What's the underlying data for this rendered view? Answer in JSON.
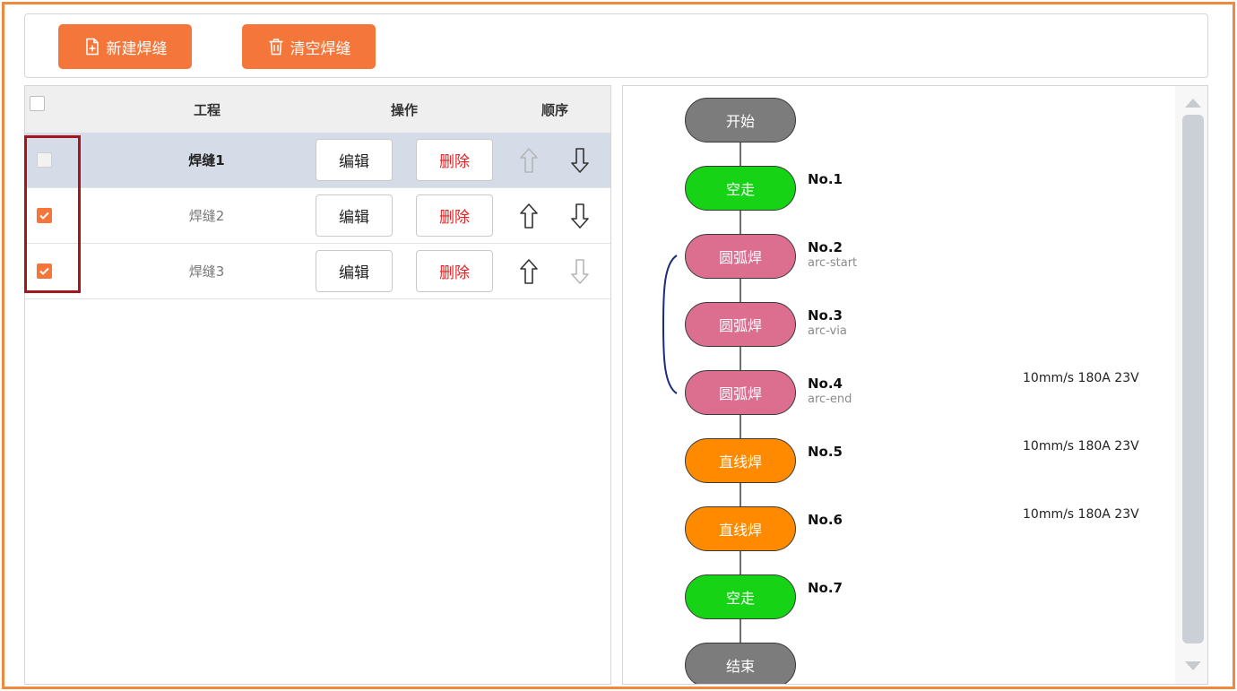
{
  "toolbar": {
    "new_label": "新建焊缝",
    "clear_label": "清空焊缝"
  },
  "table": {
    "headers": {
      "project": "工程",
      "action": "操作",
      "order": "顺序"
    },
    "rows": [
      {
        "name": "焊缝1",
        "edit": "编辑",
        "delete": "删除",
        "checked": false,
        "selected": true
      },
      {
        "name": "焊缝2",
        "edit": "编辑",
        "delete": "删除",
        "checked": true,
        "selected": false
      },
      {
        "name": "焊缝3",
        "edit": "编辑",
        "delete": "删除",
        "checked": true,
        "selected": false
      }
    ]
  },
  "flow": {
    "start": "开始",
    "end": "结束",
    "steps": [
      {
        "label": "空走",
        "no": "No.1",
        "sub": "",
        "params": ""
      },
      {
        "label": "圆弧焊",
        "no": "No.2",
        "sub": "arc-start",
        "params": ""
      },
      {
        "label": "圆弧焊",
        "no": "No.3",
        "sub": "arc-via",
        "params": ""
      },
      {
        "label": "圆弧焊",
        "no": "No.4",
        "sub": "arc-end",
        "params": "10mm/s 180A 23V"
      },
      {
        "label": "直线焊",
        "no": "No.5",
        "sub": "",
        "params": "10mm/s 180A 23V"
      },
      {
        "label": "直线焊",
        "no": "No.6",
        "sub": "",
        "params": "10mm/s 180A 23V"
      },
      {
        "label": "空走",
        "no": "No.7",
        "sub": "",
        "params": ""
      }
    ]
  },
  "colors": {
    "accent": "#f5763a",
    "frame": "#f0883e",
    "highlight": "#a3171c",
    "delete_text": "#e42424",
    "node_gray": "#7c7c7c",
    "node_green": "#16d316",
    "node_pink": "#dc6e90",
    "node_orange": "#ff8a00"
  }
}
